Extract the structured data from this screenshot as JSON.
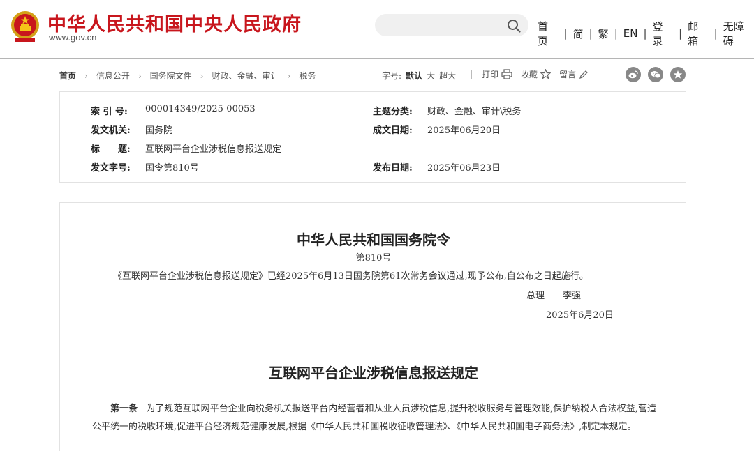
{
  "header": {
    "site_title": "中华人民共和国中央人民政府",
    "site_url": "www.gov.cn",
    "search_placeholder": "",
    "nav": [
      "首页",
      "简",
      "繁",
      "EN",
      "登录",
      "邮箱",
      "无障碍"
    ],
    "brand_color": "#c8161d"
  },
  "breadcrumb": [
    "首页",
    "信息公开",
    "国务院文件",
    "财政、金融、审计",
    "税务"
  ],
  "font_size": {
    "label": "字号:",
    "options": [
      "默认",
      "大",
      "超大"
    ],
    "current": "默认"
  },
  "tools": {
    "print": "打印",
    "favorite": "收藏",
    "comment": "留言"
  },
  "social": [
    "weibo-icon",
    "wechat-icon",
    "qzone-icon"
  ],
  "info": {
    "index_label": "索 引 号:",
    "index_value": "000014349/2025-00053",
    "topic_label": "主题分类:",
    "topic_value": "财政、金融、审计\\税务",
    "issuer_label": "发文机关:",
    "issuer_value": "国务院",
    "created_label": "成文日期:",
    "created_value": "2025年06月20日",
    "title_label": "标　　题:",
    "title_value": "互联网平台企业涉税信息报送规定",
    "docno_label": "发文字号:",
    "docno_value": "国令第810号",
    "published_label": "发布日期:",
    "published_value": "2025年06月23日"
  },
  "document": {
    "order_title": "中华人民共和国国务院令",
    "order_no": "第810号",
    "intro": "《互联网平台企业涉税信息报送规定》已经2025年6月13日国务院第61次常务会议通过,现予公布,自公布之日起施行。",
    "signer_title": "总理",
    "signer_name": "李强",
    "sign_date": "2025年6月20日",
    "regulation_title": "互联网平台企业涉税信息报送规定",
    "article_no": "第一条",
    "article_text": "为了规范互联网平台企业向税务机关报送平台内经营者和从业人员涉税信息,提升税收服务与管理效能,保护纳税人合法权益,营造公平统一的税收环境,促进平台经济规范健康发展,根据《中华人民共和国税收征收管理法》、《中华人民共和国电子商务法》,制定本规定。"
  }
}
